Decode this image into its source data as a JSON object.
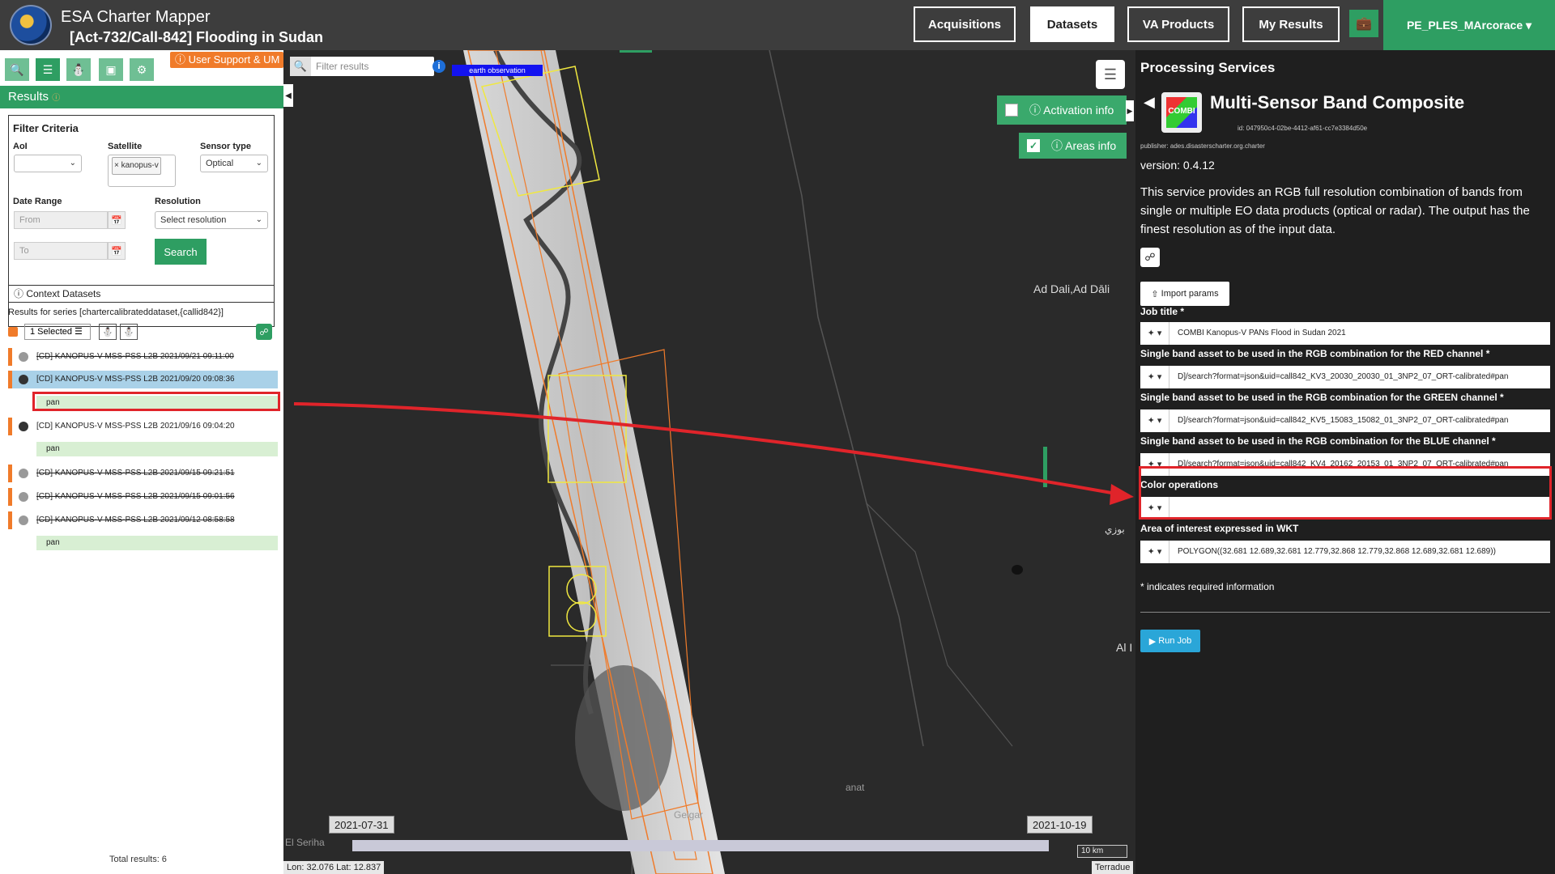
{
  "header": {
    "app_title": "ESA Charter Mapper",
    "subtitle": "[Act-732/Call-842] Flooding in Sudan",
    "nav": [
      "Acquisitions",
      "Datasets",
      "VA Products",
      "My Results"
    ],
    "active_nav": "Datasets",
    "user": "PE_PLES_MArcorace ▾"
  },
  "left": {
    "support_label": "ⓘ User Support & UM",
    "results_label": "Results",
    "filter_title": "Filter Criteria",
    "aoi_label": "AoI",
    "satellite_label": "Satellite",
    "satellite_value": "× kanopus-v",
    "sensor_label": "Sensor type",
    "sensor_value": "Optical",
    "date_label": "Date Range",
    "from_placeholder": "From",
    "to_placeholder": "To",
    "resolution_label": "Resolution",
    "resolution_value": "Select resolution",
    "search_label": "Search",
    "context_label": "Context Datasets",
    "series_text": "Results for series [chartercalibrateddataset,{callid842}]",
    "selected_label": "1 Selected",
    "items": [
      {
        "label": "[CD] KANOPUS-V MSS-PSS L2B 2021/09/21 09:11:00",
        "strike": true
      },
      {
        "label": "[CD] KANOPUS-V MSS-PSS L2B 2021/09/20 09:08:36",
        "strike": false,
        "highlight": true
      },
      {
        "label": "[CD] KANOPUS-V MSS-PSS L2B 2021/09/16 09:04:20",
        "strike": false
      },
      {
        "label": "[CD] KANOPUS-V MSS-PSS L2B 2021/09/15 09:21:51",
        "strike": true
      },
      {
        "label": "[CD] KANOPUS-V MSS-PSS L2B 2021/09/15 09:01:56",
        "strike": true
      },
      {
        "label": "[CD] KANOPUS-V MSS-PSS L2B 2021/09/12 08:58:58",
        "strike": true
      }
    ],
    "pan_label": "pan",
    "total": "Total results: 6"
  },
  "map": {
    "filter_placeholder": "Filter results",
    "eo_tag": "earth observation",
    "activation_info": "ⓘ Activation info",
    "areas_info": "ⓘ Areas info",
    "places": [
      "Ad Dali,Ad Dāli",
      "بوزي",
      "Al I",
      "Geigar",
      "El Seriha",
      "anat"
    ],
    "date_start": "2021-07-31",
    "date_end": "2021-10-19",
    "scale": "10 km",
    "coords": "Lon: 32.076 Lat: 12.837",
    "attribution": "Terradue"
  },
  "right": {
    "panel_title": "Processing Services",
    "service_name": "Multi-Sensor Band Composite",
    "icon_label": "COMBI",
    "service_id": "id: 047950c4-02be-4412-af61-cc7e3384d50e",
    "publisher": "publisher: ades.disasterscharter.org.charter",
    "version": "version: 0.4.12",
    "description": "This service provides an RGB full resolution combination of bands from single or multiple EO data products (optical or radar). The output has the finest resolution as of the input data.",
    "import_label": "Import params",
    "fields": [
      {
        "label": "Job title *",
        "value": "COMBI Kanopus-V PANs Flood in Sudan 2021"
      },
      {
        "label": "Single band asset to be used in the RGB combination for the RED channel *",
        "value": "D]/search?format=json&uid=call842_KV3_20030_20030_01_3NP2_07_ORT-calibrated#pan"
      },
      {
        "label": "Single band asset to be used in the RGB combination for the GREEN channel *",
        "value": "D]/search?format=json&uid=call842_KV5_15083_15082_01_3NP2_07_ORT-calibrated#pan"
      },
      {
        "label": "Single band asset to be used in the RGB combination for the BLUE channel *",
        "value": "D]/search?format=json&uid=call842_KV4_20162_20153_01_3NP2_07_ORT-calibrated#pan"
      },
      {
        "label": "Color operations",
        "value": ""
      },
      {
        "label": "Area of interest expressed in WKT",
        "value": "POLYGON((32.681 12.689,32.681 12.779,32.868 12.779,32.868 12.689,32.681 12.689))"
      }
    ],
    "required_note": "* indicates required information",
    "run_label": "Run Job"
  },
  "colors": {
    "brand_green": "#2e9e62",
    "orange": "#f07b2a",
    "annotation_red": "#e0242a"
  }
}
